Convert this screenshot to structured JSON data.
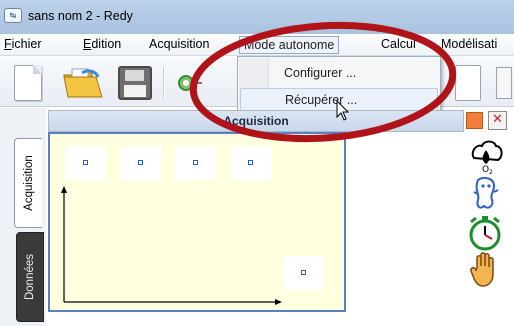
{
  "window": {
    "title": "sans nom 2 - Redy"
  },
  "menubar": {
    "items": [
      {
        "label": "Fichier",
        "underline": "F",
        "rest": "ichier"
      },
      {
        "label": "Edition",
        "underline": "E",
        "rest": "dition"
      },
      {
        "label": "Acquisition",
        "underline": "",
        "rest": "Acquisition"
      },
      {
        "label": "Mode autonome",
        "underline": "",
        "rest": "Mode autonome"
      },
      {
        "label": "Calcul",
        "underline": "",
        "rest": "Calcul"
      },
      {
        "label": "Modélisati",
        "underline": "",
        "rest": "Modélisati"
      }
    ]
  },
  "dropdown": {
    "items": [
      {
        "label": "Configurer ..."
      },
      {
        "label": "Récupérer ..."
      }
    ]
  },
  "tabs": {
    "acquisition": "Acquisition",
    "donnees": "Données"
  },
  "panel": {
    "title": "Acquisition"
  },
  "colors": {
    "highlight": "#b01418",
    "plot_background": "#ffffe0",
    "plot_border": "#5c7fc4",
    "orange_button": "#f07d3c"
  },
  "icons": {
    "toolbar": [
      "new-document-icon",
      "open-folder-icon",
      "save-floppy-icon",
      "gear-icon",
      "document-icon"
    ],
    "side": [
      "oxygen-sensor-icon",
      "ghost-icon",
      "stopwatch-icon",
      "hand-stop-icon"
    ]
  }
}
